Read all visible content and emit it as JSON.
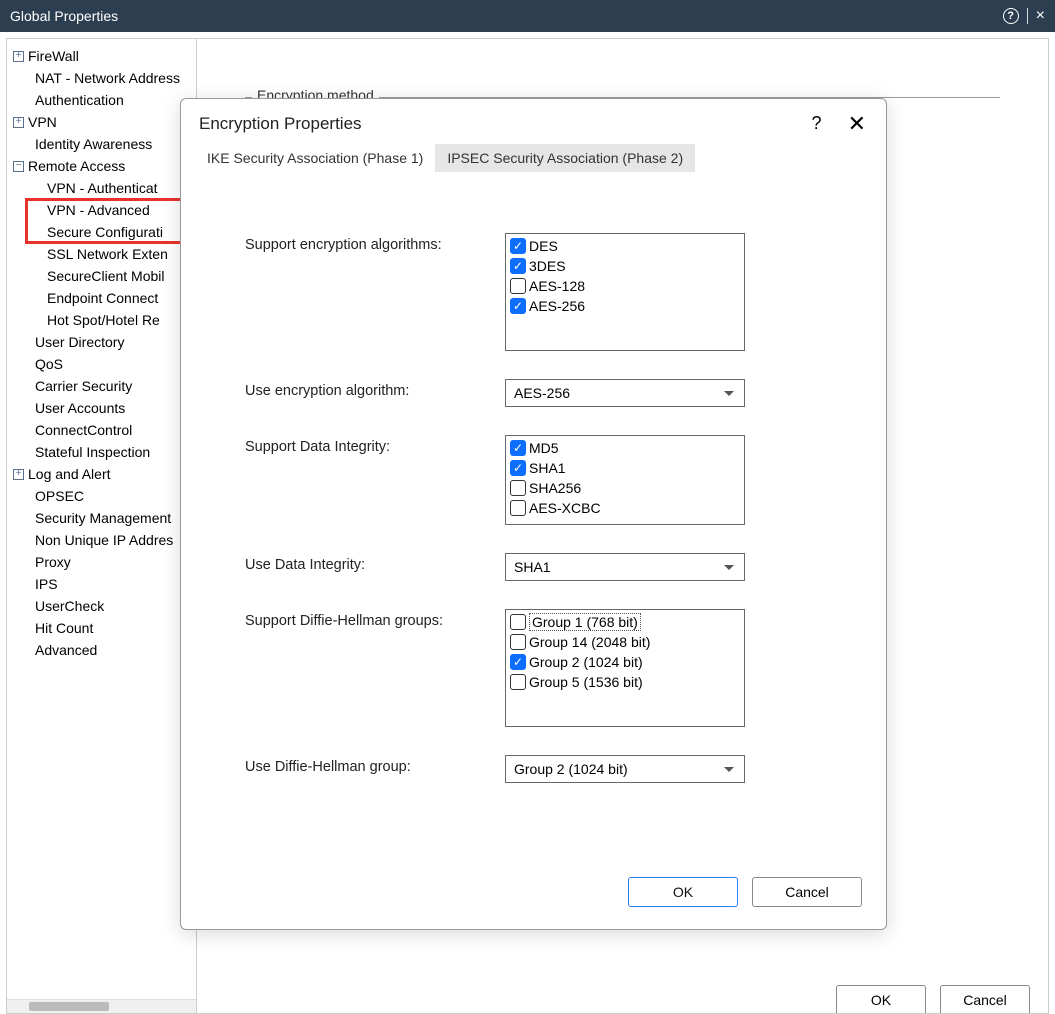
{
  "titlebar": {
    "title": "Global Properties",
    "help": "?",
    "close": "×"
  },
  "tree": {
    "firewall": "FireWall",
    "nat": "NAT - Network Address",
    "authentication": "Authentication",
    "vpn": "VPN",
    "identity": "Identity Awareness",
    "remote_access": "Remote Access",
    "vpn_auth": "VPN - Authenticat",
    "vpn_advanced": "VPN - Advanced",
    "secure_config": "Secure Configurati",
    "ssl_network": "SSL Network Exten",
    "secureclient": "SecureClient Mobil",
    "endpoint": "Endpoint Connect",
    "hotspot": "Hot Spot/Hotel Re",
    "user_directory": "User Directory",
    "qos": "QoS",
    "carrier": "Carrier Security",
    "user_accounts": "User Accounts",
    "connect_control": "ConnectControl",
    "stateful": "Stateful Inspection",
    "log_alert": "Log and Alert",
    "opsec": "OPSEC",
    "security_mgmt": "Security Management",
    "non_unique": "Non Unique IP Addres",
    "proxy": "Proxy",
    "ips": "IPS",
    "usercheck": "UserCheck",
    "hitcount": "Hit Count",
    "advanced": "Advanced"
  },
  "background": {
    "fieldset_label": "Encryption method",
    "ok": "OK",
    "cancel": "Cancel"
  },
  "dialog": {
    "title": "Encryption Properties",
    "help": "?",
    "close": "✕",
    "tabs": {
      "phase1": "IKE Security Association (Phase 1)",
      "phase2": "IPSEC Security Association (Phase 2)"
    },
    "labels": {
      "support_enc": "Support encryption algorithms:",
      "use_enc": "Use encryption algorithm:",
      "support_integrity": "Support Data Integrity:",
      "use_integrity": "Use Data Integrity:",
      "support_dh": "Support Diffie-Hellman groups:",
      "use_dh": "Use Diffie-Hellman group:"
    },
    "enc_algorithms": [
      {
        "label": "DES",
        "checked": true
      },
      {
        "label": "3DES",
        "checked": true
      },
      {
        "label": "AES-128",
        "checked": false
      },
      {
        "label": "AES-256",
        "checked": true
      }
    ],
    "use_encryption": "AES-256",
    "integrity_algorithms": [
      {
        "label": "MD5",
        "checked": true
      },
      {
        "label": "SHA1",
        "checked": true
      },
      {
        "label": "SHA256",
        "checked": false
      },
      {
        "label": "AES-XCBC",
        "checked": false
      }
    ],
    "use_integrity": "SHA1",
    "dh_groups": [
      {
        "label": "Group 1 (768 bit)",
        "checked": false,
        "dotted": true
      },
      {
        "label": "Group 14 (2048 bit)",
        "checked": false
      },
      {
        "label": "Group 2 (1024 bit)",
        "checked": true
      },
      {
        "label": "Group 5 (1536 bit)",
        "checked": false
      }
    ],
    "use_dh": "Group 2 (1024 bit)",
    "ok": "OK",
    "cancel": "Cancel"
  }
}
